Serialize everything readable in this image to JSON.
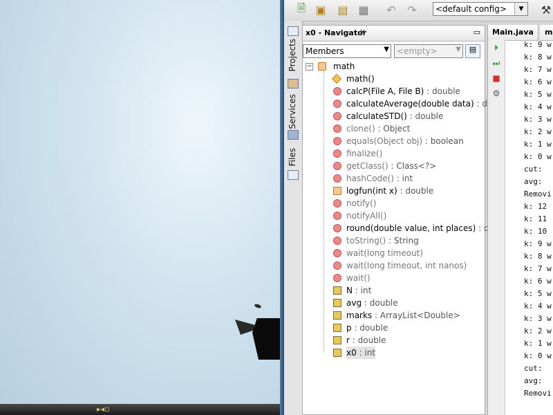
{
  "toolbar": {
    "config_value": "<default config>",
    "buttons": [
      "new-file-icon",
      "new-project-icon",
      "open-project-icon",
      "save-icon",
      "undo-icon",
      "redo-icon"
    ]
  },
  "side_tabs": [
    "Projects",
    "Services",
    "Files"
  ],
  "navigator": {
    "title": "x0 - Navigator",
    "close_glyph": "✕",
    "filter_value": "Members",
    "filter_second": "<empty>",
    "root": "math",
    "items": [
      {
        "name": "math()",
        "type": "",
        "kind": "ctor",
        "inherited": false
      },
      {
        "name": "calcP",
        "params": "(File A, File B)",
        "type": " : double",
        "kind": "method",
        "inherited": false
      },
      {
        "name": "calculateAverage",
        "params": "(double data)",
        "type": " : do",
        "kind": "method",
        "inherited": false
      },
      {
        "name": "calculateSTD()",
        "params": "",
        "type": " : double",
        "kind": "method",
        "inherited": false
      },
      {
        "name": "clone()",
        "params": "",
        "type": " : Object",
        "kind": "method",
        "inherited": true
      },
      {
        "name": "equals",
        "params": "(Object obj)",
        "type": " : boolean",
        "kind": "method",
        "inherited": true
      },
      {
        "name": "finalize()",
        "params": "",
        "type": "",
        "kind": "method",
        "inherited": true
      },
      {
        "name": "getClass()",
        "params": "",
        "type": " : Class<?>",
        "kind": "method",
        "inherited": true
      },
      {
        "name": "hashCode()",
        "params": "",
        "type": " : int",
        "kind": "method",
        "inherited": true
      },
      {
        "name": "logfun",
        "params": "(int x)",
        "type": " : double",
        "kind": "classi",
        "inherited": false
      },
      {
        "name": "notify()",
        "params": "",
        "type": "",
        "kind": "method",
        "inherited": true
      },
      {
        "name": "notifyAll()",
        "params": "",
        "type": "",
        "kind": "method",
        "inherited": true
      },
      {
        "name": "round",
        "params": "(double value, int places)",
        "type": " : do",
        "kind": "statm",
        "inherited": false
      },
      {
        "name": "toString()",
        "params": "",
        "type": " : String",
        "kind": "method",
        "inherited": true
      },
      {
        "name": "wait",
        "params": "(long timeout)",
        "type": "",
        "kind": "method",
        "inherited": true
      },
      {
        "name": "wait",
        "params": "(long timeout, int nanos)",
        "type": "",
        "kind": "method",
        "inherited": true
      },
      {
        "name": "wait()",
        "params": "",
        "type": "",
        "kind": "method",
        "inherited": true
      },
      {
        "name": "N",
        "params": "",
        "type": " : int",
        "kind": "field",
        "inherited": false
      },
      {
        "name": "avg",
        "params": "",
        "type": " : double",
        "kind": "field",
        "inherited": false
      },
      {
        "name": "marks",
        "params": "",
        "type": " : ArrayList<Double>",
        "kind": "field",
        "inherited": false
      },
      {
        "name": "p",
        "params": "",
        "type": " : double",
        "kind": "field",
        "inherited": false
      },
      {
        "name": "r",
        "params": "",
        "type": " : double",
        "kind": "field",
        "inherited": false
      },
      {
        "name": "x0",
        "params": "",
        "type": " : int",
        "kind": "field",
        "inherited": false
      }
    ]
  },
  "output": {
    "tabs": [
      "Main.java",
      "ma"
    ],
    "lines": [
      "k: 9 w",
      "k: 8 w",
      "k: 7 w",
      "k: 6 w",
      "k: 5 w",
      "k: 4 w",
      "k: 3 w",
      "k: 2 w",
      "k: 1 w",
      "k: 0 w",
      "cut: ",
      "avg: ",
      "Removi",
      "k: 12",
      "k: 11",
      "k: 10",
      "k: 9 w",
      "k: 8 w",
      "k: 7 w",
      "k: 6 w",
      "k: 5 w",
      "k: 4 w",
      "k: 3 w",
      "k: 2 w",
      "k: 1 w",
      "k: 0 w",
      "cut: ",
      "avg: ",
      "Removi"
    ]
  },
  "colors": {
    "accent": "#2c4a70",
    "method": "#e88a8a",
    "field": "#e8c860"
  }
}
